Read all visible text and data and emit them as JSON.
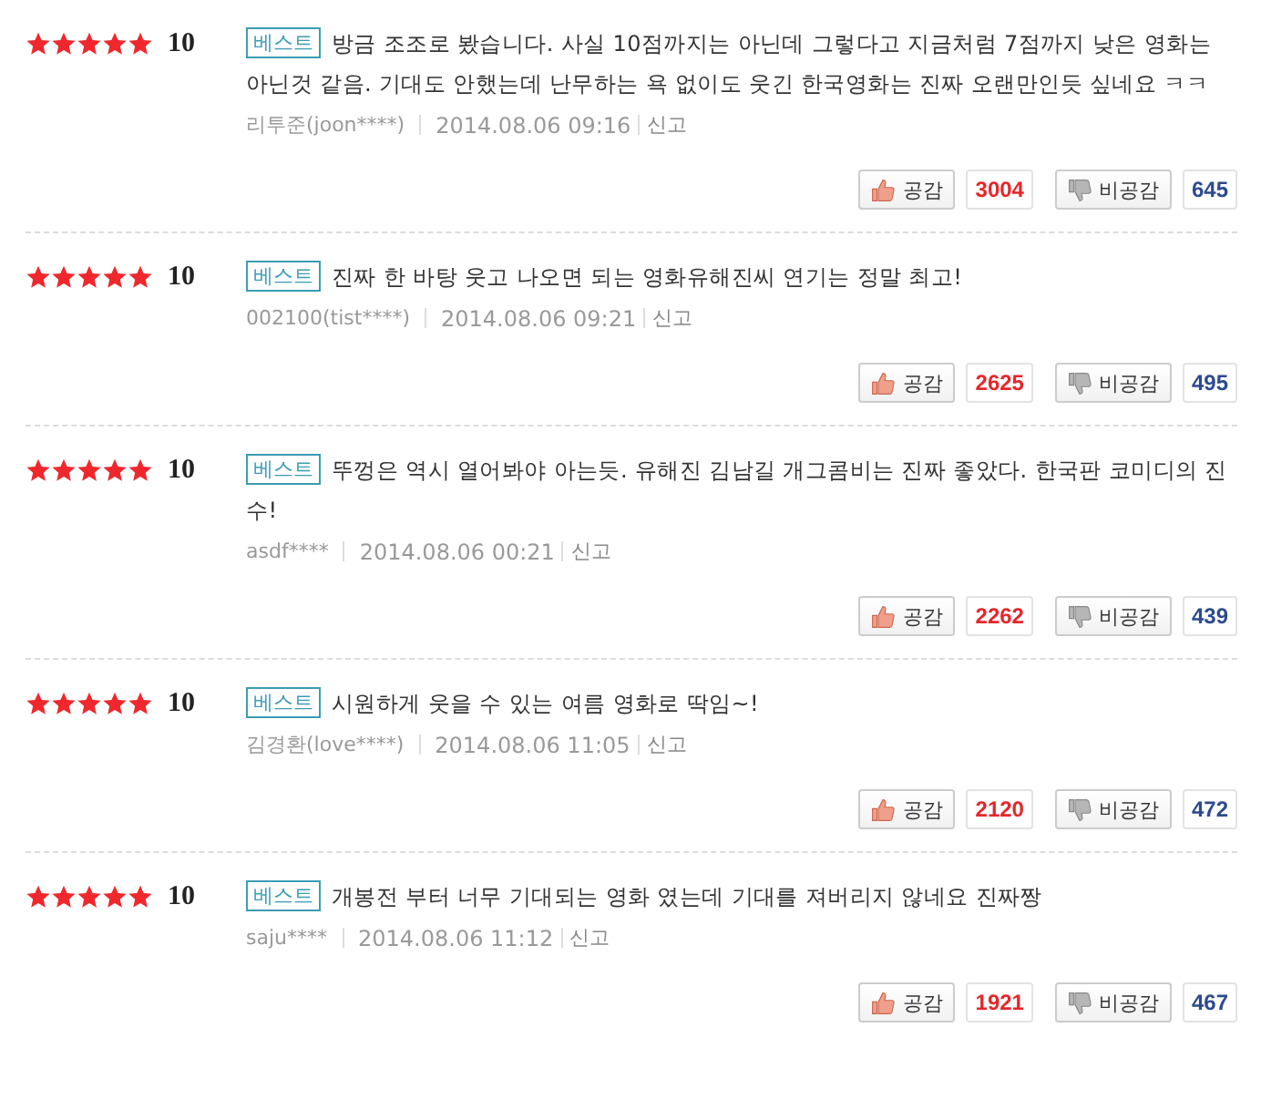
{
  "reviews": [
    {
      "stars": 5,
      "score": "10",
      "badge": "베스트",
      "text": "방금 조조로 봤습니다. 사실 10점까지는 아닌데 그렇다고 지금처럼 7점까지 낮은 영화는 아닌것 같음. 기대도 안했는데 난무하는 욕 없이도 웃긴 한국영화는 진짜 오랜만인듯 싶네요 ㅋㅋ",
      "author": "리투준(joon****)",
      "date": "2014.08.06 09:16",
      "report": "신고",
      "like_label": "공감",
      "likes": "3004",
      "dislike_label": "비공감",
      "dislikes": "645"
    },
    {
      "stars": 5,
      "score": "10",
      "badge": "베스트",
      "text": "진짜 한 바탕 웃고 나오면 되는 영화유해진씨 연기는 정말 최고!",
      "author": "002100(tist****)",
      "date": "2014.08.06 09:21",
      "report": "신고",
      "like_label": "공감",
      "likes": "2625",
      "dislike_label": "비공감",
      "dislikes": "495"
    },
    {
      "stars": 5,
      "score": "10",
      "badge": "베스트",
      "text": "뚜껑은 역시 열어봐야 아는듯. 유해진 김남길 개그콤비는 진짜 좋았다. 한국판 코미디의 진수!",
      "author": "asdf****",
      "date": "2014.08.06 00:21",
      "report": "신고",
      "like_label": "공감",
      "likes": "2262",
      "dislike_label": "비공감",
      "dislikes": "439"
    },
    {
      "stars": 5,
      "score": "10",
      "badge": "베스트",
      "text": "시원하게 웃을 수 있는 여름 영화로 딱임~!",
      "author": "김경환(love****)",
      "date": "2014.08.06 11:05",
      "report": "신고",
      "like_label": "공감",
      "likes": "2120",
      "dislike_label": "비공감",
      "dislikes": "472"
    },
    {
      "stars": 5,
      "score": "10",
      "badge": "베스트",
      "text": "개봉전 부터 너무 기대되는 영화 였는데 기대를 져버리지 않네요 진짜짱",
      "author": "saju****",
      "date": "2014.08.06 11:12",
      "report": "신고",
      "like_label": "공감",
      "likes": "1921",
      "dislike_label": "비공감",
      "dislikes": "467"
    }
  ]
}
